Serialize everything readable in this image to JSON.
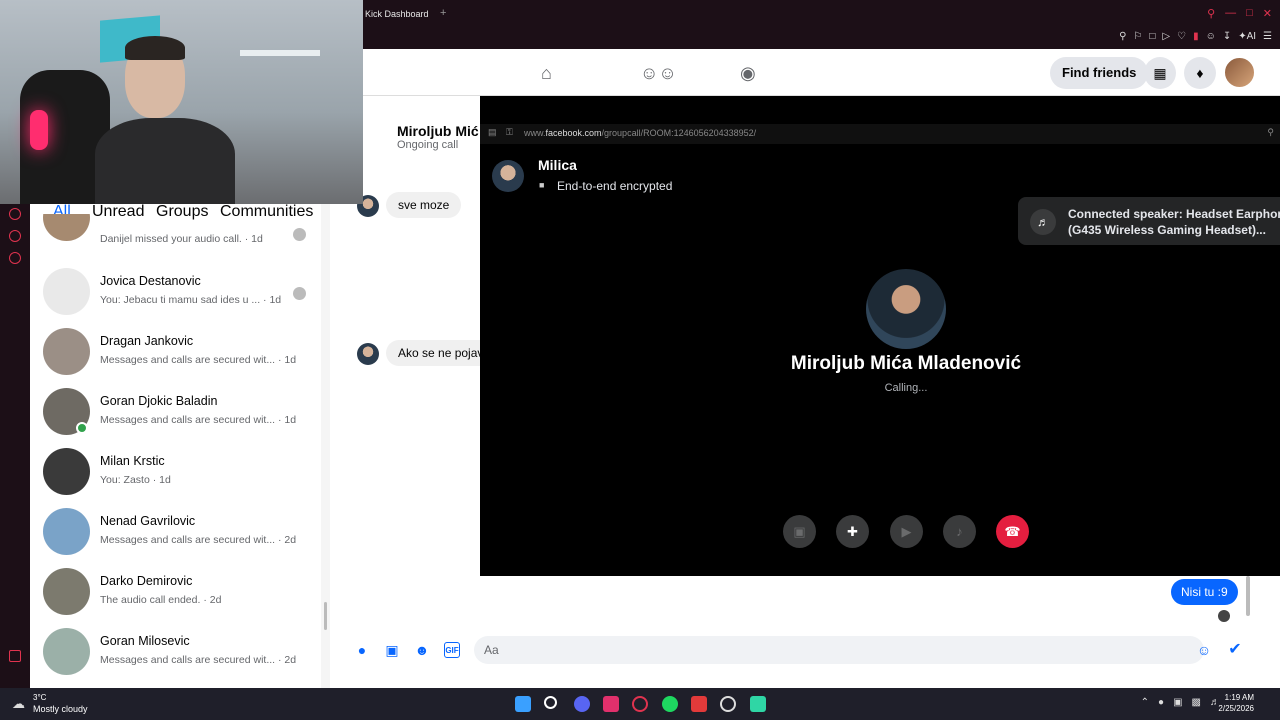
{
  "browser": {
    "tab_title": "Kick Dashboard",
    "new_tab": "+"
  },
  "fb_header": {
    "find_friends": "Find friends",
    "icons": [
      "home-icon",
      "friends-icon",
      "groups-icon",
      "apps-grid-icon",
      "notifications-icon"
    ]
  },
  "chat_list": {
    "filters": [
      "All",
      "Unread",
      "Groups",
      "Communities"
    ],
    "active_filter": "All",
    "items": [
      {
        "name": "",
        "preview": "Danijel missed your audio call. · 1d"
      },
      {
        "name": "Jovica Destanovic",
        "preview": "You: Jebacu ti mamu sad ides u ... · 1d"
      },
      {
        "name": "Dragan Jankovic",
        "preview": "Messages and calls are secured wit... · 1d"
      },
      {
        "name": "Goran Djokic Baladin",
        "preview": "Messages and calls are secured wit... · 1d"
      },
      {
        "name": "Milan Krstic",
        "preview": "You: Zasto · 1d"
      },
      {
        "name": "Nenad Gavrilovic",
        "preview": "Messages and calls are secured wit... · 2d"
      },
      {
        "name": "Darko Demirovic",
        "preview": "The audio call ended. · 2d"
      },
      {
        "name": "Goran Milosevic",
        "preview": "Messages and calls are secured wit... · 2d"
      }
    ]
  },
  "conversation": {
    "name": "Miroljub Mić",
    "status": "Ongoing call",
    "messages_in": [
      "sve moze",
      "Ako se ne pojav"
    ],
    "message_out": "Nisi tu :9",
    "composer_placeholder": "Aa"
  },
  "call": {
    "url_prefix": "www.",
    "url_domain": "facebook.com",
    "url_path": "/groupcall/ROOM:1246056204338952/",
    "group_name": "Milica",
    "encryption": "End-to-end encrypted",
    "speaker_notice": "Connected speaker: Headset Earphon (G435 Wireless Gaming Headset)...",
    "callee_name": "Miroljub Mića Mladenović",
    "status": "Calling..."
  },
  "taskbar": {
    "temperature": "3°C",
    "weather": "Mostly cloudy",
    "time": "1:19 AM",
    "date": "2/25/2026"
  },
  "colors": {
    "fb_blue": "#0866ff",
    "end_call_red": "#e41e3f",
    "opera_red": "#e0334f"
  }
}
